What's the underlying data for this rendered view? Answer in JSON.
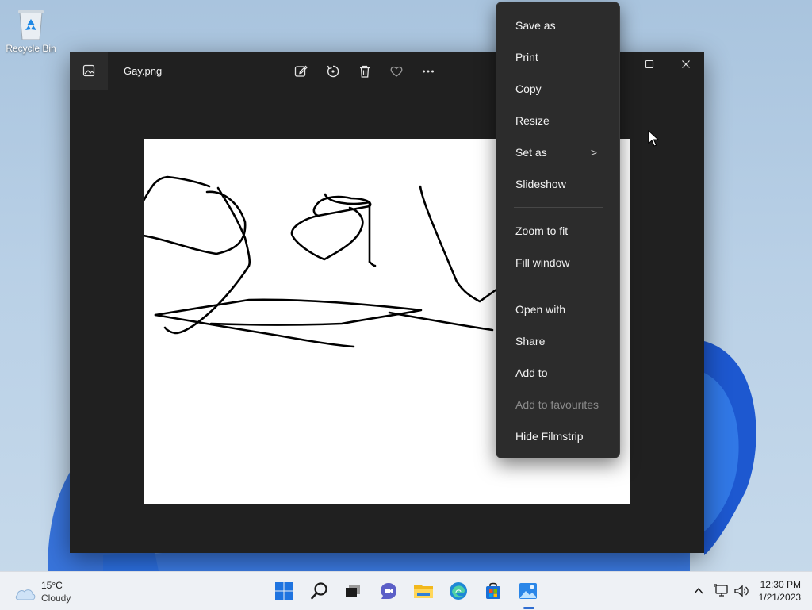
{
  "desktop": {
    "icons": [
      {
        "label": "Recycle Bin",
        "icon": "recycle-bin-icon"
      }
    ]
  },
  "photos_window": {
    "file_name": "Gay.png",
    "toolbar": [
      {
        "name": "edit-image-button",
        "icon": "edit-image-icon"
      },
      {
        "name": "rotate-button",
        "icon": "rotate-icon"
      },
      {
        "name": "delete-button",
        "icon": "trash-icon"
      },
      {
        "name": "favourite-button",
        "icon": "heart-icon"
      },
      {
        "name": "more-options-button",
        "icon": "ellipsis-icon"
      }
    ],
    "caption_buttons": [
      "maximize",
      "close"
    ]
  },
  "context_menu": {
    "items": [
      {
        "label": "Save as"
      },
      {
        "label": "Print"
      },
      {
        "label": "Copy"
      },
      {
        "label": "Resize"
      },
      {
        "label": "Set as",
        "submenu": true
      },
      {
        "label": "Slideshow"
      },
      {
        "label": "Zoom to fit"
      },
      {
        "label": "Fill window"
      },
      {
        "label": "Open with"
      },
      {
        "label": "Share"
      },
      {
        "label": "Add to"
      },
      {
        "label": "Add to favourites",
        "disabled": true
      },
      {
        "label": "Hide Filmstrip"
      }
    ],
    "submenu_glyph": ">"
  },
  "taskbar": {
    "weather": {
      "temp": "15°C",
      "condition": "Cloudy"
    },
    "apps": [
      "start-icon",
      "search-icon",
      "task-view-icon",
      "chat-icon",
      "file-explorer-icon",
      "edge-icon",
      "store-icon",
      "photos-icon"
    ],
    "tray": [
      "chevron-up-icon",
      "network-icon",
      "volume-icon"
    ],
    "clock": {
      "time": "12:30 PM",
      "date": "1/21/2023"
    }
  },
  "colors": {
    "accent": "#2f6dd1",
    "window_bg": "#202020",
    "menu_bg": "#2c2c2c"
  }
}
